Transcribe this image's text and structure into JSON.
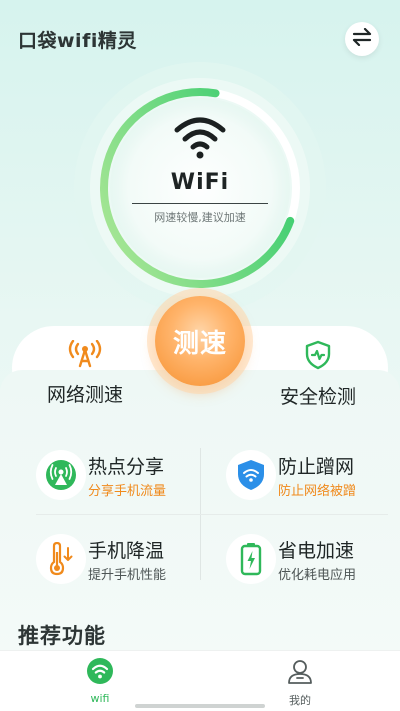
{
  "header": {
    "title": "口袋wifi精灵",
    "switch_icon": "swap-arrows-icon"
  },
  "gauge": {
    "network_name": "WiFi",
    "status_text": "网速较慢,建议加速",
    "progress": 0.72,
    "colors": {
      "start": "#a8e58c",
      "end": "#26c96a",
      "track": "#ffffff"
    }
  },
  "tools": {
    "speed_button": "测速",
    "network_speed": {
      "label": "网络测速",
      "icon": "signal-tower-icon"
    },
    "security": {
      "label": "安全检测",
      "icon": "shield-pulse-icon"
    }
  },
  "features": [
    {
      "title": "热点分享",
      "subtitle": "分享手机流量",
      "icon": "hotspot-icon"
    },
    {
      "title": "防止蹭网",
      "subtitle": "防止网络被蹭",
      "icon": "wifi-shield-icon"
    },
    {
      "title": "手机降温",
      "subtitle": "提升手机性能",
      "icon": "thermometer-icon"
    },
    {
      "title": "省电加速",
      "subtitle": "优化耗电应用",
      "icon": "battery-icon"
    }
  ],
  "recommend": {
    "title": "推荐功能"
  },
  "tabbar": {
    "tabs": [
      {
        "label": "wifi",
        "icon": "wifi-tab-icon",
        "active": true
      },
      {
        "label": "我的",
        "icon": "user-icon",
        "active": false
      }
    ]
  },
  "colors": {
    "accent_green": "#2fb85a",
    "accent_orange": "#f08a1c",
    "background": "#d6f3ee"
  }
}
